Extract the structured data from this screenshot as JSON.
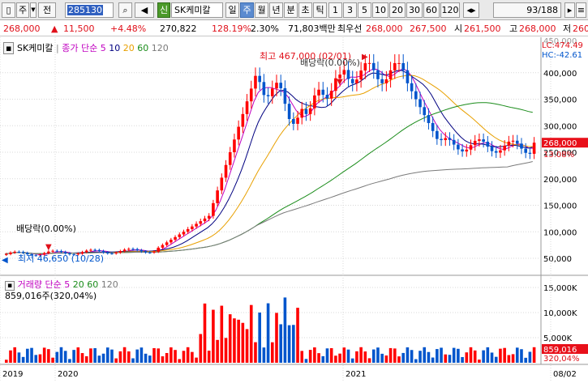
{
  "toolbar": {
    "market": "주",
    "period_kind": "전",
    "code": "285130",
    "credit_badge": "신",
    "stock_name": "SK케미칼",
    "interval_tabs": [
      "일",
      "주",
      "월",
      "년",
      "분",
      "초",
      "틱"
    ],
    "active_interval": "주",
    "n_buttons": [
      "1",
      "3",
      "5",
      "10",
      "20",
      "30",
      "60",
      "120"
    ],
    "page_counter": "93/188"
  },
  "price_bar": {
    "price": "268,000",
    "change": "11,500",
    "change_pct": "+4.48%",
    "volume": "270,822",
    "volume_ratio": "128.19%",
    "turnover_pct": "2.30%",
    "amount": "71,803백만",
    "best_ask_label": "최우선",
    "best_ask": "268,000",
    "best_bid": "267,500",
    "open_label": "시",
    "open": "261,500",
    "high_label": "고",
    "high": "268,000",
    "low_label": "저",
    "low": "260,"
  },
  "price_panel": {
    "stock_label": "SK케미칼",
    "ma_label": "종가 단순",
    "ma_periods": [
      "5",
      "10",
      "20",
      "60",
      "120"
    ],
    "ma_colors": [
      "#c000c0",
      "#000080",
      "#e8a000",
      "#1a8c1a",
      "#7a7a7a"
    ],
    "lc_label": "LC:474.49",
    "hc_label": "HC:-42.61",
    "current_price_tag": "268,000",
    "current_pct_tag": "13.08%",
    "high_annotation": "최고 467,000 (02/01)",
    "low_annotation": "최저 46,650 (10/28)",
    "dividend_label_1": "배당락(0.00%)",
    "dividend_label_2": "배당락(0.00%)",
    "y_ticks": [
      "400,000",
      "350,000",
      "300,000",
      "250,000",
      "200,000",
      "150,000",
      "100,000",
      "50,000"
    ],
    "y_tick_values": [
      400000,
      350000,
      300000,
      250000,
      200000,
      150000,
      100000,
      50000
    ],
    "y_top_cut": "450,000",
    "y_top_cut_value": 450000
  },
  "volume_panel": {
    "label": "거래량",
    "ma_label": "단순",
    "ma_periods": [
      "5",
      "20",
      "60",
      "120"
    ],
    "ma_colors": [
      "#c000c0",
      "#1a8c1a",
      "#1a8c1a",
      "#7a7a7a"
    ],
    "current_volume_label": "859,016주(320,04%)",
    "y_ticks": [
      "15,000K",
      "10,000K",
      "5,000K"
    ],
    "y_tick_values": [
      15000,
      10000,
      5000
    ],
    "volume_tag": "859,016",
    "volume_pct_tag": "320,04%"
  },
  "x_axis": {
    "labels": [
      "2019",
      "2020",
      "2021",
      "08/02"
    ]
  },
  "colors": {
    "up": "#ff0000",
    "down": "#0055cc",
    "panel_bg": "#ffffff",
    "tag_bg": "#e8101a"
  }
}
